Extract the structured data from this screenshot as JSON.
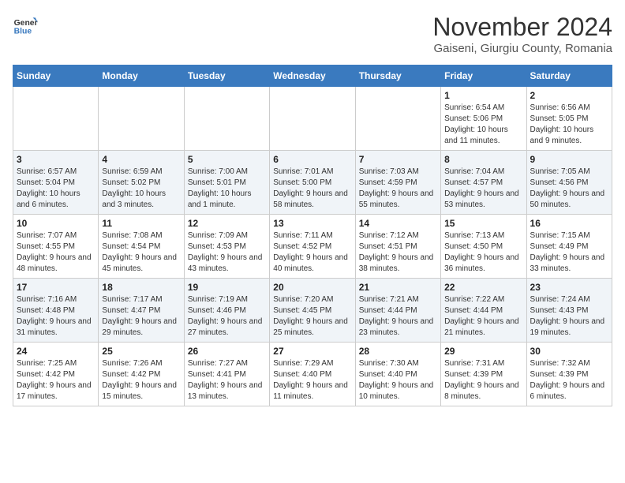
{
  "header": {
    "logo_text_general": "General",
    "logo_text_blue": "Blue",
    "month_title": "November 2024",
    "location": "Gaiseni, Giurgiu County, Romania"
  },
  "weekdays": [
    "Sunday",
    "Monday",
    "Tuesday",
    "Wednesday",
    "Thursday",
    "Friday",
    "Saturday"
  ],
  "weeks": [
    [
      {
        "day": "",
        "info": ""
      },
      {
        "day": "",
        "info": ""
      },
      {
        "day": "",
        "info": ""
      },
      {
        "day": "",
        "info": ""
      },
      {
        "day": "",
        "info": ""
      },
      {
        "day": "1",
        "info": "Sunrise: 6:54 AM\nSunset: 5:06 PM\nDaylight: 10 hours and 11 minutes."
      },
      {
        "day": "2",
        "info": "Sunrise: 6:56 AM\nSunset: 5:05 PM\nDaylight: 10 hours and 9 minutes."
      }
    ],
    [
      {
        "day": "3",
        "info": "Sunrise: 6:57 AM\nSunset: 5:04 PM\nDaylight: 10 hours and 6 minutes."
      },
      {
        "day": "4",
        "info": "Sunrise: 6:59 AM\nSunset: 5:02 PM\nDaylight: 10 hours and 3 minutes."
      },
      {
        "day": "5",
        "info": "Sunrise: 7:00 AM\nSunset: 5:01 PM\nDaylight: 10 hours and 1 minute."
      },
      {
        "day": "6",
        "info": "Sunrise: 7:01 AM\nSunset: 5:00 PM\nDaylight: 9 hours and 58 minutes."
      },
      {
        "day": "7",
        "info": "Sunrise: 7:03 AM\nSunset: 4:59 PM\nDaylight: 9 hours and 55 minutes."
      },
      {
        "day": "8",
        "info": "Sunrise: 7:04 AM\nSunset: 4:57 PM\nDaylight: 9 hours and 53 minutes."
      },
      {
        "day": "9",
        "info": "Sunrise: 7:05 AM\nSunset: 4:56 PM\nDaylight: 9 hours and 50 minutes."
      }
    ],
    [
      {
        "day": "10",
        "info": "Sunrise: 7:07 AM\nSunset: 4:55 PM\nDaylight: 9 hours and 48 minutes."
      },
      {
        "day": "11",
        "info": "Sunrise: 7:08 AM\nSunset: 4:54 PM\nDaylight: 9 hours and 45 minutes."
      },
      {
        "day": "12",
        "info": "Sunrise: 7:09 AM\nSunset: 4:53 PM\nDaylight: 9 hours and 43 minutes."
      },
      {
        "day": "13",
        "info": "Sunrise: 7:11 AM\nSunset: 4:52 PM\nDaylight: 9 hours and 40 minutes."
      },
      {
        "day": "14",
        "info": "Sunrise: 7:12 AM\nSunset: 4:51 PM\nDaylight: 9 hours and 38 minutes."
      },
      {
        "day": "15",
        "info": "Sunrise: 7:13 AM\nSunset: 4:50 PM\nDaylight: 9 hours and 36 minutes."
      },
      {
        "day": "16",
        "info": "Sunrise: 7:15 AM\nSunset: 4:49 PM\nDaylight: 9 hours and 33 minutes."
      }
    ],
    [
      {
        "day": "17",
        "info": "Sunrise: 7:16 AM\nSunset: 4:48 PM\nDaylight: 9 hours and 31 minutes."
      },
      {
        "day": "18",
        "info": "Sunrise: 7:17 AM\nSunset: 4:47 PM\nDaylight: 9 hours and 29 minutes."
      },
      {
        "day": "19",
        "info": "Sunrise: 7:19 AM\nSunset: 4:46 PM\nDaylight: 9 hours and 27 minutes."
      },
      {
        "day": "20",
        "info": "Sunrise: 7:20 AM\nSunset: 4:45 PM\nDaylight: 9 hours and 25 minutes."
      },
      {
        "day": "21",
        "info": "Sunrise: 7:21 AM\nSunset: 4:44 PM\nDaylight: 9 hours and 23 minutes."
      },
      {
        "day": "22",
        "info": "Sunrise: 7:22 AM\nSunset: 4:44 PM\nDaylight: 9 hours and 21 minutes."
      },
      {
        "day": "23",
        "info": "Sunrise: 7:24 AM\nSunset: 4:43 PM\nDaylight: 9 hours and 19 minutes."
      }
    ],
    [
      {
        "day": "24",
        "info": "Sunrise: 7:25 AM\nSunset: 4:42 PM\nDaylight: 9 hours and 17 minutes."
      },
      {
        "day": "25",
        "info": "Sunrise: 7:26 AM\nSunset: 4:42 PM\nDaylight: 9 hours and 15 minutes."
      },
      {
        "day": "26",
        "info": "Sunrise: 7:27 AM\nSunset: 4:41 PM\nDaylight: 9 hours and 13 minutes."
      },
      {
        "day": "27",
        "info": "Sunrise: 7:29 AM\nSunset: 4:40 PM\nDaylight: 9 hours and 11 minutes."
      },
      {
        "day": "28",
        "info": "Sunrise: 7:30 AM\nSunset: 4:40 PM\nDaylight: 9 hours and 10 minutes."
      },
      {
        "day": "29",
        "info": "Sunrise: 7:31 AM\nSunset: 4:39 PM\nDaylight: 9 hours and 8 minutes."
      },
      {
        "day": "30",
        "info": "Sunrise: 7:32 AM\nSunset: 4:39 PM\nDaylight: 9 hours and 6 minutes."
      }
    ]
  ]
}
